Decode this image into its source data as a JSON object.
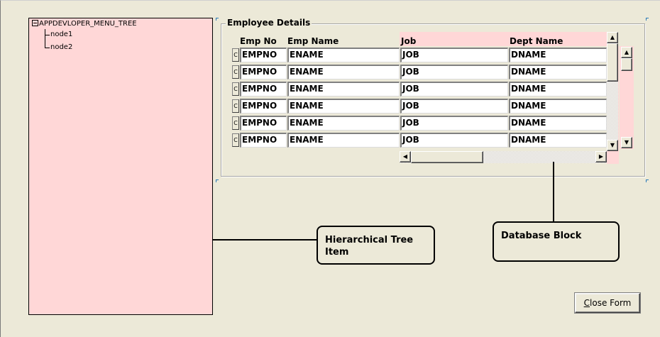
{
  "tree": {
    "root_label": "APPDEVLOPER_MENU_TREE",
    "nodes": [
      "node1",
      "node2"
    ]
  },
  "employee_block": {
    "title": "Employee Details",
    "columns": [
      "Emp No",
      "Emp Name",
      "Job",
      "Dept Name"
    ],
    "rows": [
      {
        "selector": "C",
        "empno": "EMPNO",
        "ename": "ENAME",
        "job": "JOB",
        "dname": "DNAME"
      },
      {
        "selector": "C",
        "empno": "EMPNO",
        "ename": "ENAME",
        "job": "JOB",
        "dname": "DNAME"
      },
      {
        "selector": "C",
        "empno": "EMPNO",
        "ename": "ENAME",
        "job": "JOB",
        "dname": "DNAME"
      },
      {
        "selector": "C",
        "empno": "EMPNO",
        "ename": "ENAME",
        "job": "JOB",
        "dname": "DNAME"
      },
      {
        "selector": "C",
        "empno": "EMPNO",
        "ename": "ENAME",
        "job": "JOB",
        "dname": "DNAME"
      },
      {
        "selector": "C",
        "empno": "EMPNO",
        "ename": "ENAME",
        "job": "JOB",
        "dname": "DNAME"
      }
    ]
  },
  "callouts": {
    "tree_item": "Hierarchical Tree Item",
    "database_block": "Database Block"
  },
  "buttons": {
    "close_form_underlined": "C",
    "close_form_rest": "lose Form"
  },
  "colors": {
    "background": "#ece9d8",
    "pink": "#ffd7d7"
  }
}
